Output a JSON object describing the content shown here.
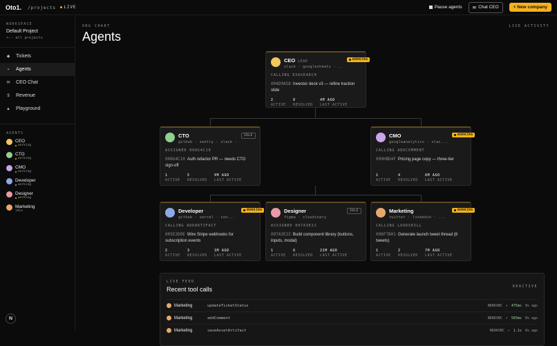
{
  "topbar": {
    "logo": "Oto1.",
    "crumb": "/projects",
    "live": "LIVE",
    "pause": "Pause agents",
    "chat_ceo": "Chat CEO",
    "new_company": "+ New company"
  },
  "sidebar": {
    "workspace_label": "WORKSPACE",
    "project": "Default Project",
    "all_projects": "<-- all projects",
    "nav": [
      {
        "label": "Tickets",
        "icon": "◆"
      },
      {
        "label": "Agents",
        "icon": "▪"
      },
      {
        "label": "CEO Chat",
        "icon": "✉"
      },
      {
        "label": "Revenue",
        "icon": "$"
      },
      {
        "label": "Playground",
        "icon": "▲"
      }
    ],
    "agents_label": "AGENTS",
    "agents": [
      {
        "name": "CEO",
        "status": "working",
        "color": "#f2c75c"
      },
      {
        "name": "CTO",
        "status": "working",
        "color": "#8fd18f"
      },
      {
        "name": "CMO",
        "status": "working",
        "color": "#c9a6e8"
      },
      {
        "name": "Developer",
        "status": "working",
        "color": "#8fa8e8"
      },
      {
        "name": "Designer",
        "status": "working",
        "color": "#e89aa8"
      },
      {
        "name": "Marketing",
        "status": "idle",
        "color": "#e8a86c"
      }
    ]
  },
  "main": {
    "org_label": "ORG CHART",
    "title": "Agents",
    "live_activity": "LIVE ACTIVITY"
  },
  "cards": {
    "ceo": {
      "name": "CEO",
      "tag": "LEAD",
      "tools": "slack · googlesheets · ...",
      "badge": "WORKING",
      "calling": "CALLING EXASEARCH",
      "task_id": "004D9A58",
      "task": "Investor deck v3 — refine traction slide",
      "active": "2",
      "resolved": "8",
      "last": "4M AGO"
    },
    "cto": {
      "name": "CTO",
      "tools": "github · sentry · slack · ...",
      "badge": "IDLE",
      "calling": "ASSIGNED 008G4C10",
      "task_id": "008G4C10",
      "task": "Auth refactor PR — needs CTO sign-off",
      "active": "1",
      "resolved": "5",
      "last": "9M AGO"
    },
    "cmo": {
      "name": "CMO",
      "tools": "googleanalytics · slac...",
      "badge": "WORKING",
      "calling": "CALLING ADDCOMMENT",
      "task_id": "009HBD4F",
      "task": "Pricing page copy — three-tier",
      "active": "1",
      "resolved": "4",
      "last": "6M AGO"
    },
    "developer": {
      "name": "Developer",
      "tools": "github · vercel · con...",
      "badge": "WORKING",
      "calling": "CALLING ADDARTIFACT",
      "task_id": "005E2D0E",
      "task": "Wire Stripe webhooks for subscription events",
      "active": "2",
      "resolved": "3",
      "last": "3M AGO"
    },
    "designer": {
      "name": "Designer",
      "tools": "figma · cloudinary",
      "badge": "IDLE",
      "calling": "ASSIGNED 007A3E22",
      "task_id": "007A3E22",
      "task": "Build component library (buttons, inputs, modal)",
      "active": "1",
      "resolved": "6",
      "last": "22M AGO"
    },
    "marketing": {
      "name": "Marketing",
      "tools": "twitter · linkedin · ...",
      "badge": "WORKING",
      "calling": "CALLING LOADSKILL",
      "task_id": "006F7B01",
      "task": "Generate launch tweet thread (8 tweets)",
      "active": "1",
      "resolved": "2",
      "last": "7M AGO"
    }
  },
  "stat_labels": {
    "active": "ACTIVE",
    "resolved": "RESOLVED",
    "last": "LAST ACTIVE"
  },
  "feed": {
    "label": "LIVE FEED",
    "title": "Recent tool calls",
    "reactive": "REACTIVE",
    "rows": [
      {
        "agent": "Marketing",
        "tool": "updateTicketStatus",
        "id": "ND86VBC",
        "dur": "475ms",
        "ago": "0s ago"
      },
      {
        "agent": "Marketing",
        "tool": "addComment",
        "id": "ND86VBC",
        "dur": "583ms",
        "ago": "0s ago"
      },
      {
        "agent": "Marketing",
        "tool": "saveAssetArtifact",
        "id": "ND86VBC",
        "dur": "1.1s",
        "ago": "0s ago"
      }
    ]
  },
  "help_icon": "N"
}
